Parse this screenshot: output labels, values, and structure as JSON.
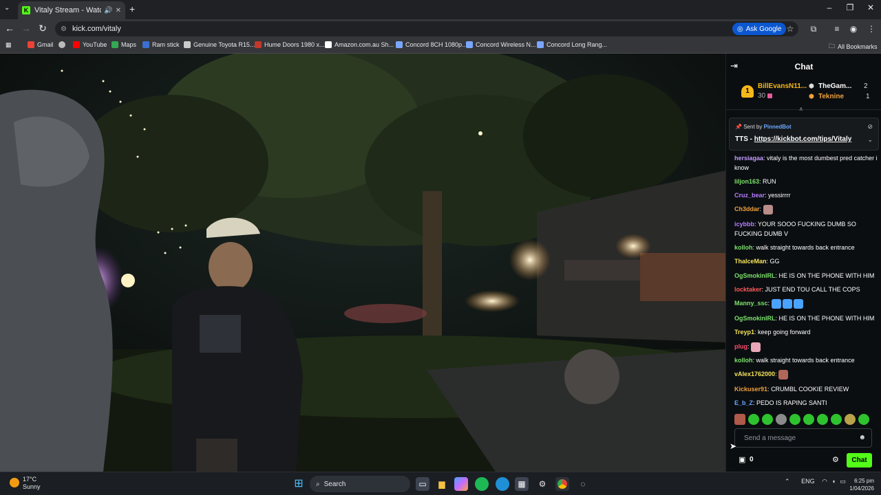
{
  "browser": {
    "tab_title": "Vitaly Stream - Watch Live ...",
    "tab_favicon": "K",
    "url": "kick.com/vitaly",
    "ask_google": "Ask Google",
    "bookmarks": [
      {
        "label": "Gmail",
        "color": "#ea4335"
      },
      {
        "label": "",
        "color": "#bbbbbb"
      },
      {
        "label": "YouTube",
        "color": "#ff0000"
      },
      {
        "label": "Maps",
        "color": "#34a853"
      },
      {
        "label": "Ram stick",
        "color": "#3b6fd1"
      },
      {
        "label": "Genuine Toyota R15...",
        "color": "#cccccc"
      },
      {
        "label": "Hume Doors 1980 x...",
        "color": "#c0392b"
      },
      {
        "label": "Amazon.com.au Sh...",
        "color": "#ffffff"
      },
      {
        "label": "Concord 8CH 1080p...",
        "color": "#7aa6ff"
      },
      {
        "label": "Concord Wireless N...",
        "color": "#7aa6ff"
      },
      {
        "label": "Concord Long Rang...",
        "color": "#7aa6ff"
      }
    ],
    "all_bookmarks": "All Bookmarks"
  },
  "chat": {
    "title": "Chat",
    "leaderboard": {
      "rank": "1",
      "first_name": "BillEvansN11...",
      "first_count": "30",
      "second_name": "TheGam...",
      "second_count": "2",
      "third_name": "Teknine",
      "third_count": "1"
    },
    "pinned": {
      "sent_by": "Sent by",
      "bot": "PinnedBot",
      "prefix": "TTS - ",
      "link": "https://kickbot.com/tips/Vitaly"
    },
    "messages": [
      {
        "user": "hersiagaa",
        "color": "#c49bff",
        "text": "vitaly is the most dumbest pred catcher i know"
      },
      {
        "user": "liljon163",
        "color": "#7be36a",
        "text": "RUN"
      },
      {
        "user": "Cruz_bear",
        "color": "#b57dff",
        "text": "yessirrrr"
      },
      {
        "user": "Ch3ddar",
        "color": "#f0a13c",
        "text": "",
        "emote": "#b98e8a"
      },
      {
        "user": "icybbb",
        "color": "#b57dff",
        "text": "YOUR SOOO FUCKING DUMB SO FUCKING DUMB V"
      },
      {
        "user": "kolloh",
        "color": "#7be36a",
        "text": "walk straight towards back entrance"
      },
      {
        "user": "ThaIceMan",
        "color": "#f5e35a",
        "text": "GG"
      },
      {
        "user": "OgSmokinIRL",
        "color": "#7be36a",
        "text": "HE IS ON THE PHONE WITH HIM"
      },
      {
        "user": "locktaker",
        "color": "#ff5a5a",
        "text": "JUST END TOU CALL THE COPS"
      },
      {
        "user": "Manny_ssc",
        "color": "#7be36a",
        "text": "",
        "emote": "#4aa3ff",
        "emote_count": 3
      },
      {
        "user": "OgSmokinIRL",
        "color": "#7be36a",
        "text": "HE IS ON THE PHONE WITH HIM"
      },
      {
        "user": "Treyp1",
        "color": "#f5e35a",
        "text": "keep going forward"
      },
      {
        "user": "plug",
        "color": "#ff4d6d",
        "text": "",
        "emote": "#e8a8b8"
      },
      {
        "user": "kolloh",
        "color": "#7be36a",
        "text": "walk straight towards back entrance"
      },
      {
        "user": "vAlex1762000",
        "color": "#f5e35a",
        "text": "",
        "emote": "#b0675a"
      },
      {
        "user": "Kickuser91",
        "color": "#f0a13c",
        "text": "CRUMBL COOKIE REVIEW"
      },
      {
        "user": "E_b_Z",
        "color": "#6aa8ff",
        "text": "PEDO IS RAPING SANTI"
      }
    ],
    "input_placeholder": "Send a message",
    "footer_count": "0",
    "chat_button": "Chat"
  },
  "taskbar": {
    "temp": "17°C",
    "condition": "Sunny",
    "search": "Search",
    "lang": "ENG",
    "time": "6:25 pm",
    "date": "1/04/2026"
  },
  "colors": {
    "kick_green": "#53fc18",
    "gold": "#f5b81b"
  }
}
